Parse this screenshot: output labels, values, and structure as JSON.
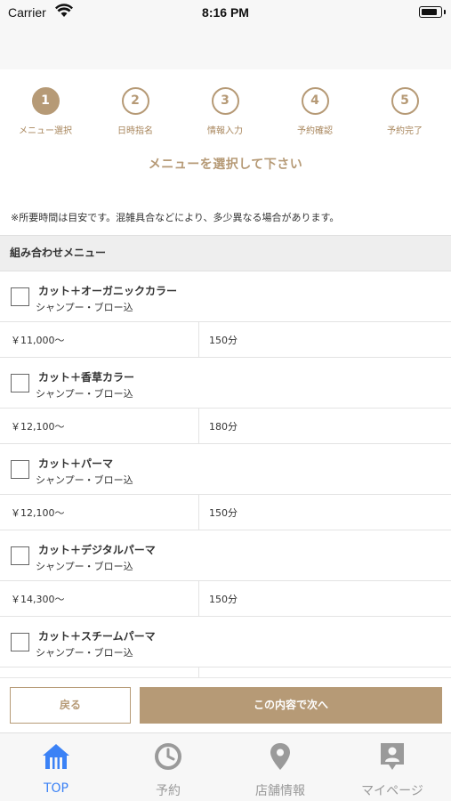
{
  "status_bar": {
    "carrier": "Carrier",
    "time": "8:16 PM",
    "battery_level": 0.85
  },
  "steps": [
    {
      "number": "1",
      "label": "メニュー選択",
      "active": true
    },
    {
      "number": "2",
      "label": "日時指名",
      "active": false
    },
    {
      "number": "3",
      "label": "情報入力",
      "active": false
    },
    {
      "number": "4",
      "label": "予約確認",
      "active": false
    },
    {
      "number": "5",
      "label": "予約完了",
      "active": false
    }
  ],
  "heading": "メニューを選択して下さい",
  "notice": "※所要時間は目安です。混雑具合などにより、多少異なる場合があります。",
  "section_title": "組み合わせメニュー",
  "menu_items": [
    {
      "name": "カット＋オーガニックカラー",
      "sub": "シャンプー・ブロー込",
      "price": "￥11,000〜",
      "duration": "150分",
      "checked": false
    },
    {
      "name": "カット＋香草カラー",
      "sub": "シャンプー・ブロー込",
      "price": "￥12,100〜",
      "duration": "180分",
      "checked": false
    },
    {
      "name": "カット＋パーマ",
      "sub": "シャンプー・ブロー込",
      "price": "￥12,100〜",
      "duration": "150分",
      "checked": false
    },
    {
      "name": "カット＋デジタルパーマ",
      "sub": "シャンプー・ブロー込",
      "price": "￥14,300〜",
      "duration": "150分",
      "checked": false
    },
    {
      "name": "カット＋スチームパーマ",
      "sub": "シャンプー・ブロー込",
      "price": "",
      "duration": "",
      "checked": false
    }
  ],
  "buttons": {
    "back": "戻る",
    "next": "この内容で次へ"
  },
  "tabs": [
    {
      "label": "TOP",
      "icon": "home-icon",
      "active": true
    },
    {
      "label": "予約",
      "icon": "clock-icon",
      "active": false
    },
    {
      "label": "店舗情報",
      "icon": "location-pin-icon",
      "active": false
    },
    {
      "label": "マイページ",
      "icon": "profile-card-icon",
      "active": false
    }
  ],
  "colors": {
    "accent": "#b69a76",
    "tab_active": "#3b82f6",
    "tab_inactive": "#9a9a9a"
  }
}
